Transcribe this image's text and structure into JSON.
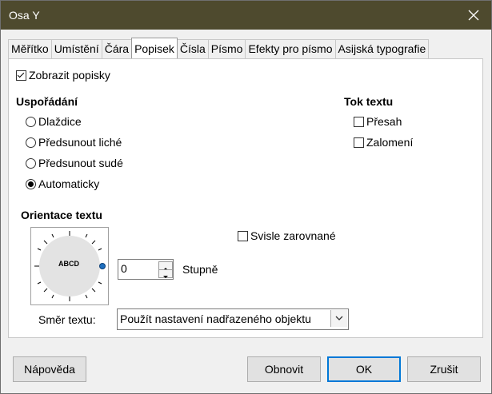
{
  "window": {
    "title": "Osa Y"
  },
  "tabs": [
    {
      "label": "Měřítko",
      "active": false
    },
    {
      "label": "Umístění",
      "active": false
    },
    {
      "label": "Čára",
      "active": false
    },
    {
      "label": "Popisek",
      "active": true
    },
    {
      "label": "Čísla",
      "active": false
    },
    {
      "label": "Písmo",
      "active": false
    },
    {
      "label": "Efekty pro písmo",
      "active": false
    },
    {
      "label": "Asijská typografie",
      "active": false
    }
  ],
  "show_labels": {
    "label": "Zobrazit popisky",
    "checked": true
  },
  "arrangement": {
    "heading": "Uspořádání",
    "options": [
      {
        "label": "Dlaždice",
        "checked": false
      },
      {
        "label": "Předsunout liché",
        "checked": false
      },
      {
        "label": "Předsunout sudé",
        "checked": false
      },
      {
        "label": "Automaticky",
        "checked": true
      }
    ]
  },
  "text_flow": {
    "heading": "Tok textu",
    "overlap": {
      "label": "Přesah",
      "checked": false
    },
    "break": {
      "label": "Zalomení",
      "checked": false
    }
  },
  "orientation": {
    "heading": "Orientace textu",
    "dial_text": "ABCD",
    "vertical_stacked": {
      "label": "Svisle zarovnané",
      "checked": false
    },
    "degrees_value": "0",
    "degrees_label": "Stupně"
  },
  "text_direction": {
    "label": "Směr textu:",
    "value": "Použít nastavení nadřazeného objektu"
  },
  "buttons": {
    "help": "Nápověda",
    "reset": "Obnovit",
    "ok": "OK",
    "cancel": "Zrušit"
  }
}
